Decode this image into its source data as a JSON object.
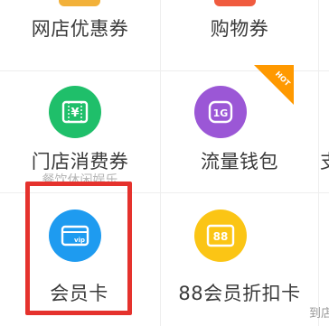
{
  "cells": {
    "online_coupon": {
      "label": "网店优惠券"
    },
    "shopping_coupon": {
      "label": "购物券"
    },
    "store_consumption_coupon": {
      "label": "门店消费券",
      "sublabel": "餐饮休闲娱乐"
    },
    "traffic_wallet": {
      "label": "流量钱包"
    },
    "member_card": {
      "label": "会员卡"
    },
    "discount_card_88": {
      "label": "88会员折扣卡",
      "icon_text": "88"
    },
    "partial_right_top": {
      "label": "支"
    },
    "partial_right_bottom": {
      "label": "到店"
    }
  },
  "badge": {
    "text": "HOT"
  },
  "colors": {
    "green": "#1fbf6a",
    "purple": "#9b57d6",
    "blue": "#1e9bf0",
    "yellow": "#fbc515",
    "orange": "#ff9900",
    "highlight_red": "#e5322d"
  },
  "icons": {
    "store_consumption_coupon": "yen-ticket-icon",
    "traffic_wallet": "traffic-card-icon",
    "member_card": "vip-card-icon",
    "discount_card_88": "discount-88-icon"
  }
}
